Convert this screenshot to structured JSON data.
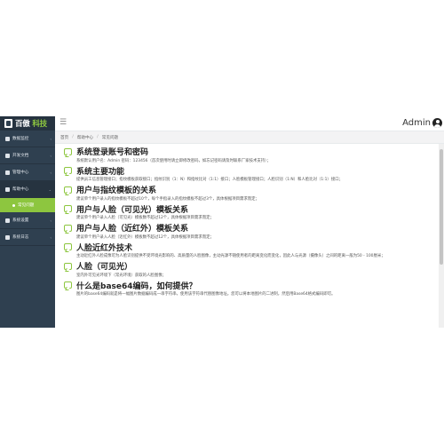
{
  "brand": {
    "name_part1": "百傲",
    "name_part2": "科技"
  },
  "sidebar": {
    "items": [
      {
        "label": "数据监控",
        "icon": "monitor-icon"
      },
      {
        "label": "开发文档",
        "icon": "document-icon"
      },
      {
        "label": "管理中心",
        "icon": "management-icon"
      },
      {
        "label": "帮助中心",
        "icon": "help-icon",
        "open": true
      },
      {
        "label": "系统设置",
        "icon": "settings-icon"
      },
      {
        "label": "系统日志",
        "icon": "log-icon"
      }
    ],
    "subitem": {
      "label": "常见问题"
    }
  },
  "topbar": {
    "user_name": "Admin"
  },
  "breadcrumb": [
    "首页",
    "帮助中心",
    "常见问题"
  ],
  "faq": [
    {
      "title": "系统登录账号和密码",
      "text": "系统默认用户名：Admin 密码：123456（首次使用时请立即修改密码，如忘记密码请及时联系厂家技术支持）；"
    },
    {
      "title": "系统主要功能",
      "text": "提供员工信息管理接口；指纹模板获取接口；指纹识别（1：N）和指纹比对（1:1）接口；人脸模板管理接口；人脸识别（1:N）和人脸比对（1:1）接口；"
    },
    {
      "title": "用户与指纹模板的关系",
      "text": "建议单个用户录入的指纹模板不超过10个，每个手指录入的指纹模板不超过3个，具体根据项目需求而定；"
    },
    {
      "title": "用户与人脸（可见光）模板关系",
      "text": "建议单个用户录入人脸（可见光）模板数不超过12个，具体根据项目需求而定；"
    },
    {
      "title": "用户与人脸（近红外）模板关系",
      "text": "建议单个用户录入人脸（近红外）模板数不超过12个，具体根据项目需求而定；"
    },
    {
      "title": "人脸近红外技术",
      "text": "主动近红外人脸成像可为人脸识别提供不受环境光影响的、高质量的人脸图像，主动光源不随使用者的距离变化而变化，因此人与光源（摄像头）之间的距离一般为50 - 100厘米；"
    },
    {
      "title": "人脸（可见光）",
      "text": "室内外可见光环境下（常光环境）获取的人脸图像；"
    },
    {
      "title": "什么是base64编码，如何提供？",
      "text": "图片的base64编码就是将一幅图片数据编码成一串字符串，使用该字符串代替图像地址。您可以将本地图片的二进制，然后用Base64格式编码即可。"
    }
  ],
  "colors": {
    "sidebar_bg": "#2f4050",
    "accent": "#8dc63f"
  }
}
